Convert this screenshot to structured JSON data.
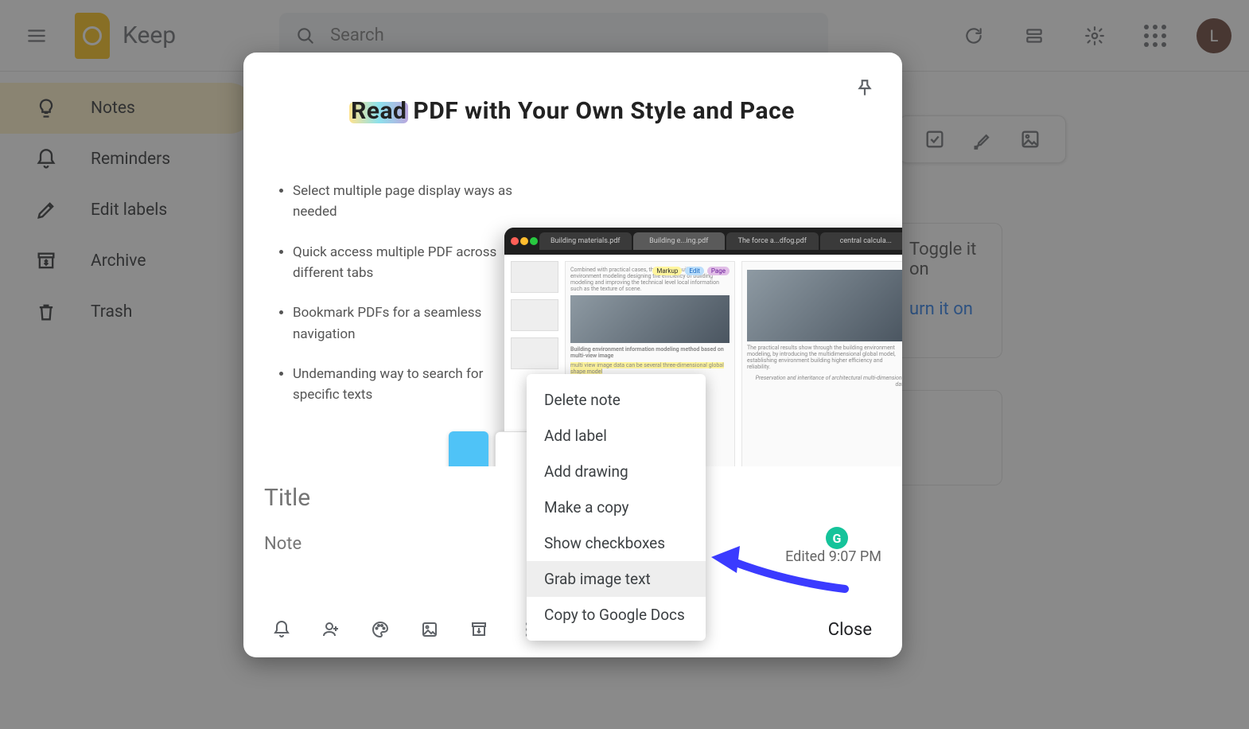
{
  "header": {
    "app_name": "Keep",
    "search_placeholder": "Search",
    "avatar_initial": "L"
  },
  "sidebar": {
    "items": [
      {
        "label": "Notes"
      },
      {
        "label": "Reminders"
      },
      {
        "label": "Edit labels"
      },
      {
        "label": "Archive"
      },
      {
        "label": "Trash"
      }
    ]
  },
  "bg_cards": {
    "card1_tail": "Toggle it on",
    "card2_tail": "urn it on"
  },
  "promo": {
    "title_hl": "Read",
    "title_rest": " PDF with Your Own Style and Pace",
    "bullets": [
      "Select multiple page display ways as needed",
      "Quick access multiple PDF across different tabs",
      "Bookmark PDFs for a seamless navigation",
      "Undemanding way to search for specific texts"
    ],
    "tabs": [
      "Building materials.pdf",
      "Building e...ing.pdf",
      "The force a...dfog.pdf",
      "central calcula..."
    ],
    "badges": {
      "markup": "Markup",
      "edit": "Edit",
      "page": "Page"
    },
    "snippet_title": "Building environment information modeling method based on multi-view image",
    "right_snippet": "Preservation and inheritance of architectural multi-dimensional data"
  },
  "editor": {
    "title_placeholder": "Title",
    "note_placeholder": "Note",
    "edited": "Edited 9:07 PM",
    "g": "G",
    "close": "Close"
  },
  "context_menu": {
    "items": [
      "Delete note",
      "Add label",
      "Add drawing",
      "Make a copy",
      "Show checkboxes",
      "Grab image text",
      "Copy to Google Docs"
    ],
    "hover_index": 5
  }
}
